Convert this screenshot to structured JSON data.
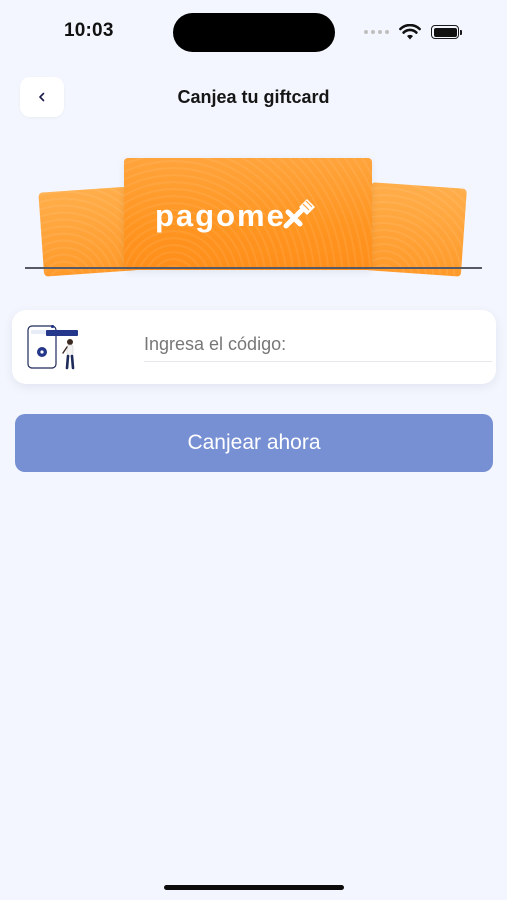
{
  "status_bar": {
    "time": "10:03"
  },
  "header": {
    "back_icon": "chevron-left-icon",
    "title": "Canjea tu giftcard"
  },
  "giftcard": {
    "brand": "pagome",
    "brand_mark_icon": "pagomex-x-logo",
    "card_color": "#ff9a2a"
  },
  "code_form": {
    "illustration": "phone-and-person-illustration",
    "placeholder": "Ingresa el código:",
    "value": ""
  },
  "redeem_button": {
    "label": "Canjear ahora",
    "color": "#7790d3"
  },
  "colors": {
    "background": "#f3f6fe",
    "accent": "#7790d3",
    "brand_orange": "#ff9521"
  }
}
